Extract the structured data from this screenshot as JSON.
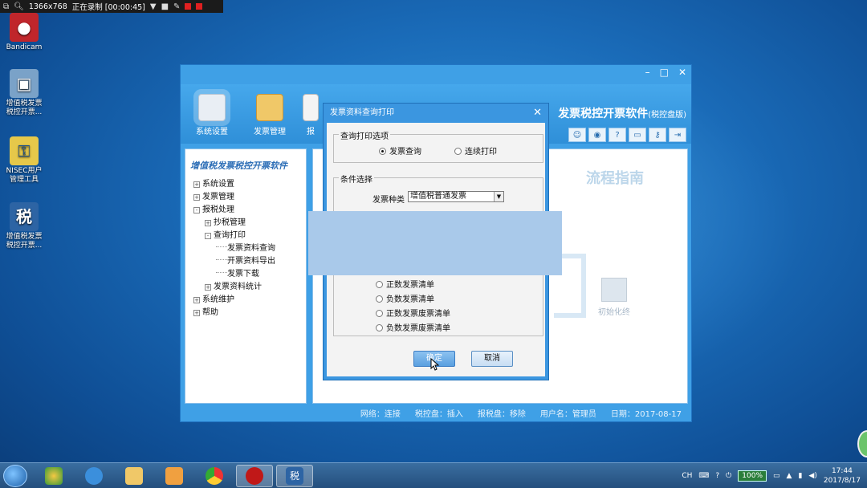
{
  "recorder": {
    "resolution": "1366x768",
    "status": "正在录制 [00:00:45]"
  },
  "desktop": {
    "icons": [
      {
        "label": "Bandicam"
      },
      {
        "label": "增值税发票\n税控开票..."
      },
      {
        "label": "NISEC用户\n管理工具"
      },
      {
        "label": "增值税发票\n税控开票..."
      }
    ]
  },
  "app": {
    "toolbar": [
      {
        "label": "系统设置"
      },
      {
        "label": "发票管理"
      },
      {
        "label": "报"
      }
    ],
    "brand": "发票税控开票软件",
    "brand_suffix": "(税控盘版)",
    "left_title": "增值税发票税控开票软件",
    "tree": [
      {
        "label": "系统设置",
        "indent": 0,
        "pm": "+"
      },
      {
        "label": "发票管理",
        "indent": 0,
        "pm": "+"
      },
      {
        "label": "报税处理",
        "indent": 0,
        "pm": "-"
      },
      {
        "label": "抄税管理",
        "indent": 1,
        "pm": "+"
      },
      {
        "label": "查询打印",
        "indent": 1,
        "pm": "-"
      },
      {
        "label": "发票资料查询",
        "indent": 2,
        "pm": ""
      },
      {
        "label": "开票资料导出",
        "indent": 2,
        "pm": ""
      },
      {
        "label": "发票下载",
        "indent": 2,
        "pm": ""
      },
      {
        "label": "发票资料统计",
        "indent": 1,
        "pm": "+"
      },
      {
        "label": "系统维护",
        "indent": 0,
        "pm": "+"
      },
      {
        "label": "帮助",
        "indent": 0,
        "pm": "+"
      }
    ],
    "flow_title": "流程指南",
    "flow_node": "初始化终",
    "status": {
      "network": "网络：连接",
      "tax_disk": "税控盘：插入",
      "report_disk": "报税盘：移除",
      "user": "用户名：管理员",
      "date": "日期：2017-08-17"
    }
  },
  "dialog": {
    "title": "发票资料查询打印",
    "group1_label": "查询打印选项",
    "option_query": "发票查询",
    "option_print": "连续打印",
    "group2_label": "条件选择",
    "invoice_type_label": "发票种类",
    "invoice_type_value": "增值税普通发票",
    "list_options": [
      "正数发票清单",
      "负数发票清单",
      "正数发票废票清单",
      "负数发票废票清单"
    ],
    "ok": "确定",
    "cancel": "取消"
  },
  "taskbar": {
    "battery": "100%",
    "lang": "CH",
    "time": "17:44",
    "date": "2017/8/17"
  },
  "colors": {
    "window_blue": "#3fa0e6",
    "dialog_blue": "#3b96e0",
    "redaction": "#a9c9ea"
  }
}
